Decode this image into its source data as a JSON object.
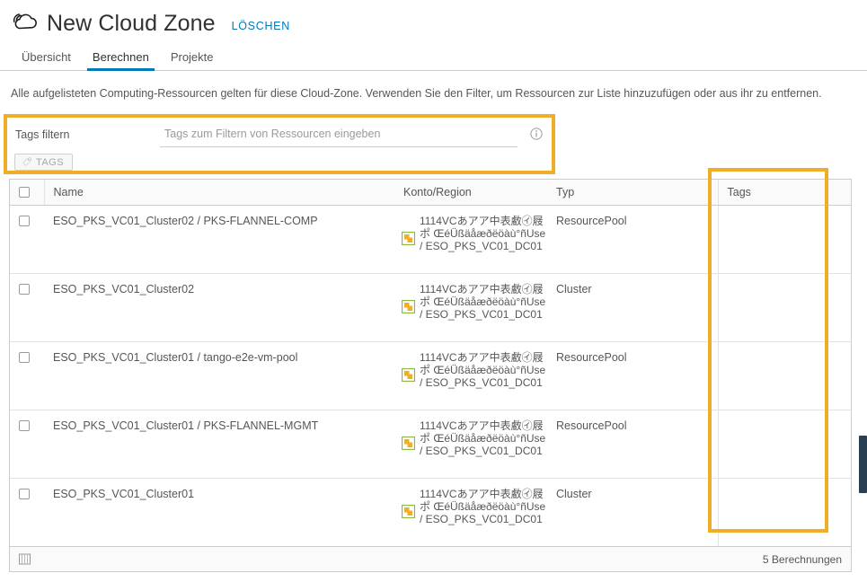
{
  "header": {
    "logo_icon": "cloud-icon",
    "title": "New Cloud Zone",
    "delete_label": "LÖSCHEN"
  },
  "tabs": [
    {
      "label": "Übersicht",
      "active": false
    },
    {
      "label": "Berechnen",
      "active": true
    },
    {
      "label": "Projekte",
      "active": false
    }
  ],
  "description": "Alle aufgelisteten Computing-Ressourcen gelten für diese Cloud-Zone. Verwenden Sie den Filter, um Ressourcen zur Liste hinzuzufügen oder aus ihr zu entfernen.",
  "filter": {
    "label": "Tags filtern",
    "input_value": "",
    "placeholder": "Tags zum Filtern von Ressourcen eingeben",
    "info_icon": "info-circle-icon",
    "tags_button_label": "TAGS",
    "tags_button_icon": "tag-icon",
    "highlight_color": "#f0ad27"
  },
  "table": {
    "columns": [
      "",
      "Name",
      "Konto/Region",
      "Typ",
      "Tags"
    ],
    "rows": [
      {
        "selected": false,
        "name": "ESO_PKS_VC01_Cluster02 / PKS-FLANNEL-COMP",
        "konto": "1114VCあアア中表䲣㋑屐ポ\nŒéÜßäåæðëöàù°ñUse /\nESO_PKS_VC01_DC01",
        "typ": "ResourcePool",
        "tags": ""
      },
      {
        "selected": false,
        "name": "ESO_PKS_VC01_Cluster02",
        "konto": "1114VCあアア中表䲣㋑屐ポ\nŒéÜßäåæðëöàù°ñUse /\nESO_PKS_VC01_DC01",
        "typ": "Cluster",
        "tags": ""
      },
      {
        "selected": false,
        "name": "ESO_PKS_VC01_Cluster01 / tango-e2e-vm-pool",
        "konto": "1114VCあアア中表䲣㋑屐ポ\nŒéÜßäåæðëöàù°ñUse /\nESO_PKS_VC01_DC01",
        "typ": "ResourcePool",
        "tags": ""
      },
      {
        "selected": false,
        "name": "ESO_PKS_VC01_Cluster01 / PKS-FLANNEL-MGMT",
        "konto": "1114VCあアア中表䲣㋑屐ポ\nŒéÜßäåæðëöàù°ñUse /\nESO_PKS_VC01_DC01",
        "typ": "ResourcePool",
        "tags": ""
      },
      {
        "selected": false,
        "name": "ESO_PKS_VC01_Cluster01",
        "konto": "1114VCあアア中表䲣㋑屐ポ\nŒéÜßäåæðëöàù°ñUse /\nESO_PKS_VC01_DC01",
        "typ": "Cluster",
        "tags": ""
      }
    ],
    "row_icon": "copy-resource-icon"
  },
  "footer": {
    "column_settings_icon": "column-settings-icon",
    "count_label": "5 Berechnungen"
  },
  "colors": {
    "accent": "#0079b8",
    "highlight": "#f0ad27",
    "text": "#565656",
    "scrollbar": "#2b3f52"
  }
}
